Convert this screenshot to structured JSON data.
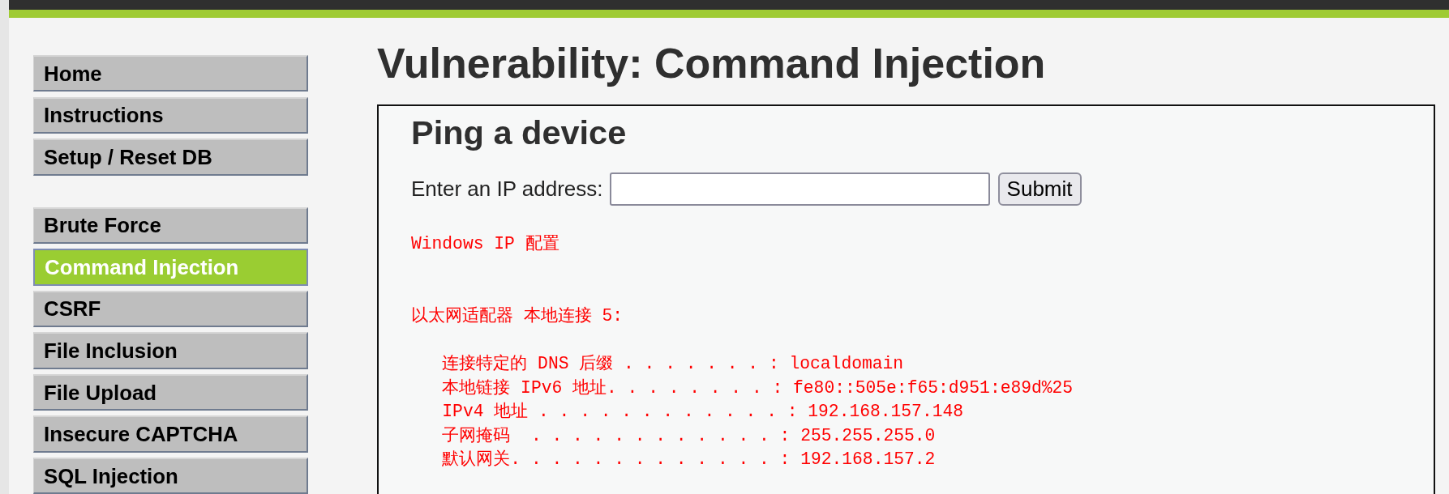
{
  "sidebar": {
    "groups": [
      {
        "items": [
          {
            "label": "Home",
            "selected": false
          },
          {
            "label": "Instructions",
            "selected": false
          },
          {
            "label": "Setup / Reset DB",
            "selected": false
          }
        ]
      },
      {
        "items": [
          {
            "label": "Brute Force",
            "selected": false
          },
          {
            "label": "Command Injection",
            "selected": true
          },
          {
            "label": "CSRF",
            "selected": false
          },
          {
            "label": "File Inclusion",
            "selected": false
          },
          {
            "label": "File Upload",
            "selected": false
          },
          {
            "label": "Insecure CAPTCHA",
            "selected": false
          },
          {
            "label": "SQL Injection",
            "selected": false
          }
        ]
      }
    ]
  },
  "title": "Vulnerability: Command Injection",
  "panel": {
    "heading": "Ping a device",
    "form": {
      "label": "Enter an IP address:",
      "submit": "Submit"
    },
    "output": {
      "title": "Windows IP 配置",
      "adapters": [
        {
          "name": "以太网适配器 本地连接 5:",
          "lines": [
            "连接特定的 DNS 后缀 . . . . . . . : localdomain",
            "本地链接 IPv6 地址. . . . . . . . : fe80::505e:f65:d951:e89d%25",
            "IPv4 地址 . . . . . . . . . . . . : 192.168.157.148",
            "子网掩码  . . . . . . . . . . . . : 255.255.255.0",
            "默认网关. . . . . . . . . . . . . : 192.168.157.2"
          ]
        }
      ]
    }
  }
}
